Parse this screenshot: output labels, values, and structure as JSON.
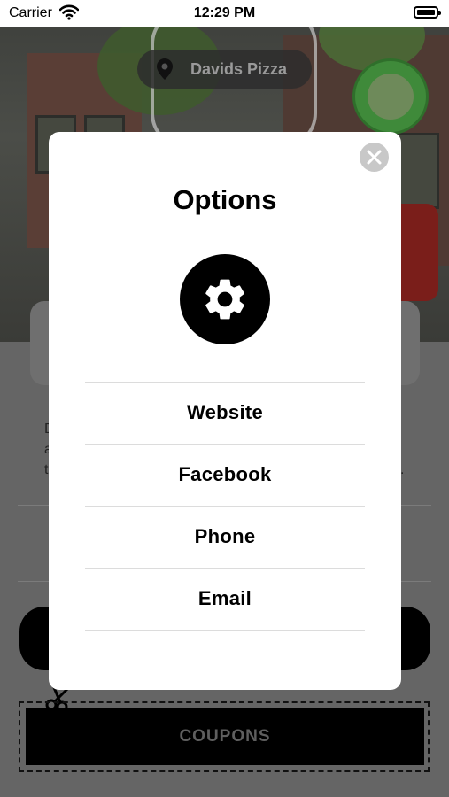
{
  "status_bar": {
    "carrier": "Carrier",
    "time": "12:29 PM"
  },
  "background": {
    "location_label": "Davids Pizza",
    "description_fragments": [
      "D",
      "a",
      "t",
      "."
    ],
    "coupons_label": "COUPONS"
  },
  "modal": {
    "title": "Options",
    "icon": "gear-icon",
    "options": [
      {
        "label": "Website"
      },
      {
        "label": "Facebook"
      },
      {
        "label": "Phone"
      },
      {
        "label": "Email"
      }
    ]
  },
  "colors": {
    "overlay": "#6b6b6b",
    "modal_bg": "#ffffff",
    "accent": "#000000",
    "close_button": "#c8c8c8"
  }
}
